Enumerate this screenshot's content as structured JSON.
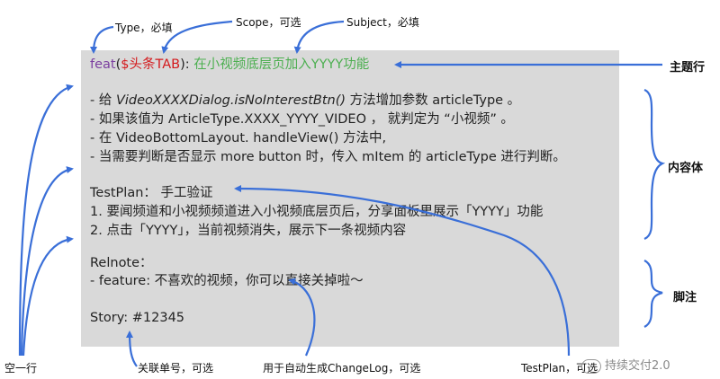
{
  "labels": {
    "type": "Type，必填",
    "scope": "Scope，可选",
    "subject": "Subject，必填",
    "subject_line": "主题行",
    "body": "内容体",
    "footer": "脚注",
    "blank_line": "空一行",
    "issue": "关联单号，可选",
    "changelog": "用于自动生成ChangeLog，可选",
    "testplan": "TestPlan，可选"
  },
  "header": {
    "type": "feat",
    "paren_open": "(",
    "scope": "$头条TAB",
    "paren_close": "):",
    "subject": " 在小视频底层页加入YYYY功能"
  },
  "body": {
    "l1_pre": "- 给 ",
    "l1_italic": "VideoXXXXDialog.isNoInterestBtn()",
    "l1_post": " 方法增加参数 articleType 。",
    "l2": "- 如果该值为 ArticleType.XXXX_YYYY_VIDEO ， 就判定为 “小视频” 。",
    "l3": "- 在 VideoBottomLayout. handleView() 方法中,",
    "l4": "- 当需要判断是否显示 more button 时，传入 mItem 的 articleType 进行判断。"
  },
  "testplan": {
    "title": "TestPlan： 手工验证",
    "l1": "1. 要闻频道和小视频频道进入小视频底层页后，分享面板里展示「YYYY」功能",
    "l2": "2. 点击「YYYY」，当前视频消失，展示下一条视频内容"
  },
  "relnote": {
    "title": "Relnote：",
    "l1": "- feature: 不喜欢的视频，你可以直接关掉啦～"
  },
  "story": {
    "line": "Story: #12345"
  },
  "watermark": "持续交付2.0",
  "colors": {
    "arrow": "#3a6fd8",
    "type": "#7b3fa0",
    "scope": "#d4191c",
    "subject": "#4caf50",
    "panel": "#d9d9d9"
  }
}
